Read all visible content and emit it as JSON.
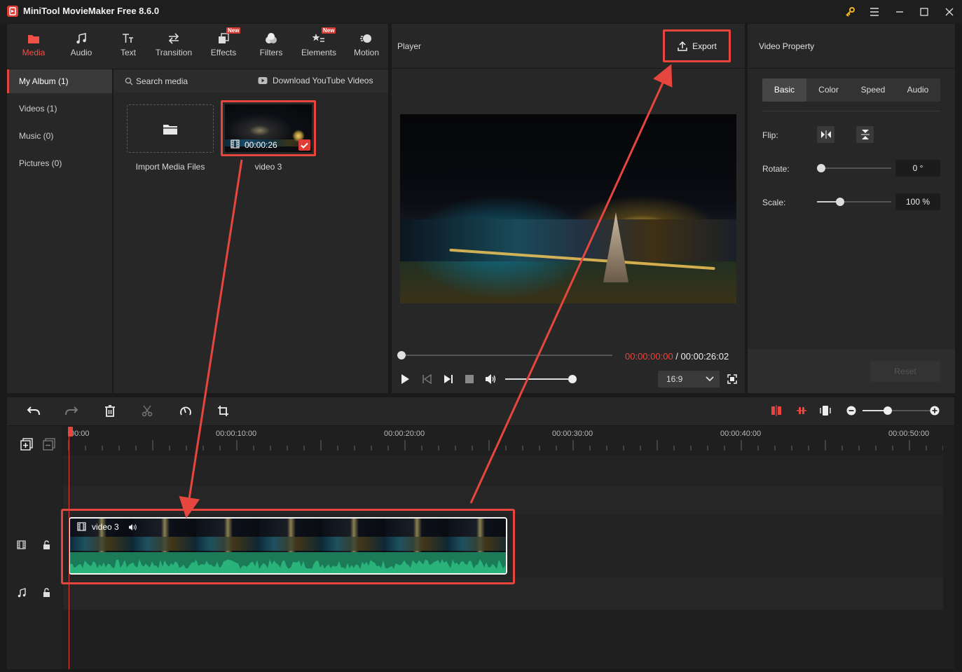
{
  "app": {
    "title": "MiniTool MovieMaker Free 8.6.0"
  },
  "toolbar": {
    "tabs": [
      {
        "label": "Media",
        "icon": "media-icon",
        "active": true
      },
      {
        "label": "Audio",
        "icon": "music-note-icon"
      },
      {
        "label": "Text",
        "icon": "text-icon"
      },
      {
        "label": "Transition",
        "icon": "transition-icon"
      },
      {
        "label": "Effects",
        "icon": "effects-icon",
        "badge": "New"
      },
      {
        "label": "Filters",
        "icon": "filters-icon"
      },
      {
        "label": "Elements",
        "icon": "elements-icon",
        "badge": "New"
      },
      {
        "label": "Motion",
        "icon": "motion-icon"
      }
    ]
  },
  "album": {
    "items": [
      {
        "label": "My Album (1)",
        "active": true
      },
      {
        "label": "Videos (1)"
      },
      {
        "label": "Music (0)"
      },
      {
        "label": "Pictures (0)"
      }
    ]
  },
  "media": {
    "search_label": "Search media",
    "download_label": "Download YouTube Videos",
    "import_label": "Import Media Files",
    "clip": {
      "name": "video 3",
      "duration": "00:00:26"
    }
  },
  "player": {
    "title": "Player",
    "export_label": "Export",
    "current_time": "00:00:00:00",
    "separator": " / ",
    "total_time": "00:00:26:02",
    "aspect_ratio": "16:9",
    "progress": 0,
    "volume": 1.0
  },
  "property": {
    "title": "Video Property",
    "tabs": [
      "Basic",
      "Color",
      "Speed",
      "Audio"
    ],
    "active_tab": "Basic",
    "flip_label": "Flip:",
    "rotate_label": "Rotate:",
    "rotate_value": "0 °",
    "rotate_fraction": 0.0,
    "scale_label": "Scale:",
    "scale_value": "100 %",
    "scale_fraction": 0.25,
    "reset_label": "Reset"
  },
  "timeline": {
    "ticks": [
      "00:00",
      "00:00:10:00",
      "00:00:20:00",
      "00:00:30:00",
      "00:00:40:00",
      "00:00:50:00"
    ],
    "clip_name": "video 3"
  },
  "colors": {
    "accent": "#e6463e",
    "waveform": "#2ab27b",
    "panel": "#272727",
    "background": "#1a1a1a"
  }
}
